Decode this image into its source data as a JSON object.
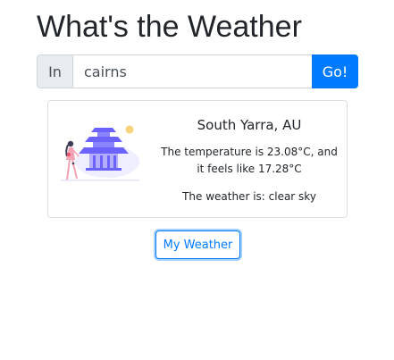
{
  "header": {
    "title": "What's the Weather"
  },
  "search": {
    "prefix_label": "In",
    "city_value": "cairns",
    "go_label": "Go!"
  },
  "weather_card": {
    "illustration_icon": "pagoda-woman-illustration-icon",
    "location": "South Yarra, AU",
    "temperature_line1": "The temperature is 23.08°C, and",
    "temperature_line2": "it feels like 17.28°C",
    "description": "The weather is: clear sky"
  },
  "actions": {
    "my_weather_label": "My Weather"
  },
  "colors": {
    "primary": "#007bff",
    "input_prefix_bg": "#e9ecef",
    "illustration_purple": "#6c63ff",
    "illustration_sun": "#f9d37b",
    "illustration_pink": "#f4a3b4"
  }
}
